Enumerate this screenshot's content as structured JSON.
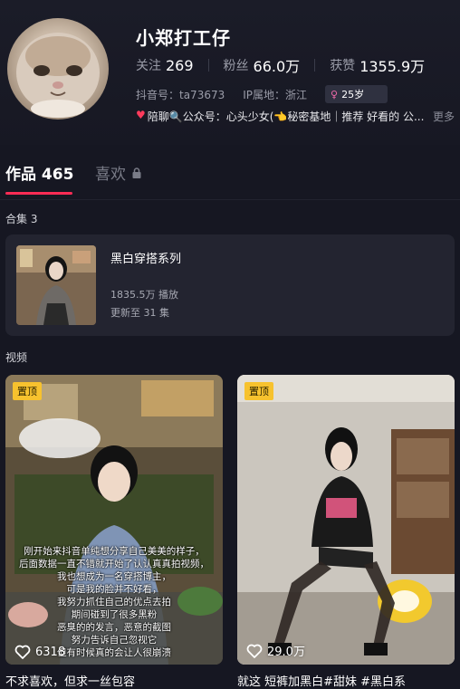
{
  "profile": {
    "name": "小郑打工仔",
    "stats": [
      {
        "label": "关注",
        "value": "269"
      },
      {
        "label": "粉丝",
        "value": "66.0万"
      },
      {
        "label": "获赞",
        "value": "1355.9万"
      }
    ],
    "douyin_id": "抖音号：ta73673",
    "ip_location": "IP属地：浙江",
    "age": "25岁",
    "bio": "陪聊🔍公众号：心头少女(👈秘密基地｜推荐 好看的 公...",
    "bio_more": "更多"
  },
  "tabs": {
    "works_label": "作品 465",
    "likes_label": "喜欢"
  },
  "collections": {
    "section_label": "合集 3",
    "item": {
      "title": "黑白穿搭系列",
      "plays": "1835.5万 播放",
      "update": "更新至 31 集"
    }
  },
  "videos": {
    "section_label": "视频",
    "items": [
      {
        "pinned_label": "置顶",
        "likes": "6318",
        "overlay_lines": [
          "刚开始来抖音单纯想分享自己美美的样子，",
          "后面数据一直不错就开始了认认真真拍视频，",
          "我也想成为一名穿搭博主，",
          "可是我的脸并不好看，",
          "我努力抓住自己的优点去拍",
          "期间碰到了很多黑粉",
          "恶臭的的发言，恶意的截图",
          "努力告诉自己忽视它",
          "但有时候真的会让人很崩溃"
        ],
        "caption": "不求喜欢，但求一丝包容"
      },
      {
        "pinned_label": "置顶",
        "likes": "29.0万",
        "caption": "就这 短裤加黑白#甜妹 #黑白系"
      }
    ]
  },
  "colors": {
    "background": "#161722",
    "accent": "#fe2c55",
    "pin_badge": "#f7c22e"
  }
}
